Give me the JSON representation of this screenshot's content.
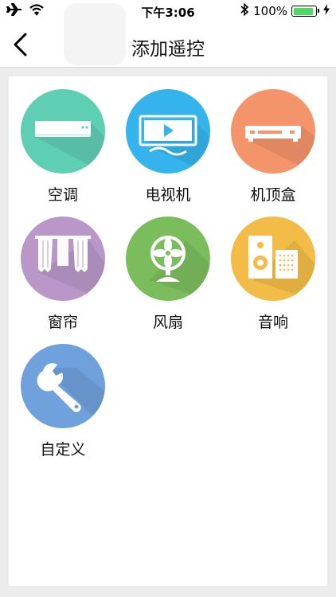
{
  "status_bar": {
    "time": "下午3:06",
    "battery_percent": "100%",
    "icons": [
      "airplane-icon",
      "wifi-icon",
      "bluetooth-icon",
      "battery-icon",
      "charging-icon"
    ]
  },
  "nav": {
    "title": "添加遥控",
    "back_icon": "chevron-left-icon"
  },
  "devices": [
    {
      "label": "空调",
      "icon": "air-conditioner-icon",
      "color": "#5fcfb3"
    },
    {
      "label": "电视机",
      "icon": "tv-icon",
      "color": "#35b3ec"
    },
    {
      "label": "机顶盒",
      "icon": "set-top-box-icon",
      "color": "#f4946a"
    },
    {
      "label": "窗帘",
      "icon": "curtain-icon",
      "color": "#b997c9"
    },
    {
      "label": "风扇",
      "icon": "fan-icon",
      "color": "#7bbd5d"
    },
    {
      "label": "音响",
      "icon": "speaker-icon",
      "color": "#f3bc46"
    },
    {
      "label": "自定义",
      "icon": "wrench-icon",
      "color": "#6fa1dc"
    }
  ]
}
